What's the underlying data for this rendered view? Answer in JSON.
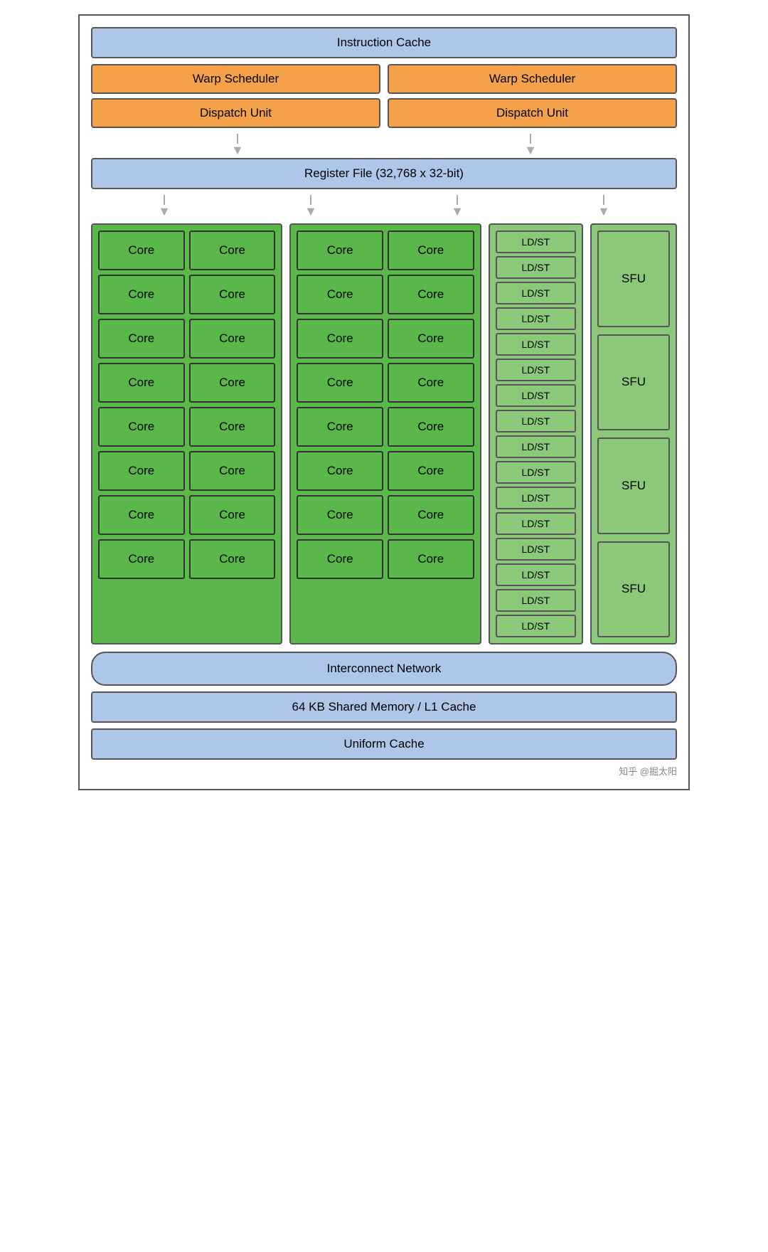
{
  "header": {
    "instruction_cache": "Instruction Cache"
  },
  "warp_schedulers": [
    "Warp Scheduler",
    "Warp Scheduler"
  ],
  "dispatch_units": [
    "Dispatch Unit",
    "Dispatch Unit"
  ],
  "register_file": "Register File (32,768 x 32-bit)",
  "core_groups": [
    {
      "rows": [
        [
          "Core",
          "Core"
        ],
        [
          "Core",
          "Core"
        ],
        [
          "Core",
          "Core"
        ],
        [
          "Core",
          "Core"
        ],
        [
          "Core",
          "Core"
        ],
        [
          "Core",
          "Core"
        ],
        [
          "Core",
          "Core"
        ],
        [
          "Core",
          "Core"
        ]
      ]
    },
    {
      "rows": [
        [
          "Core",
          "Core"
        ],
        [
          "Core",
          "Core"
        ],
        [
          "Core",
          "Core"
        ],
        [
          "Core",
          "Core"
        ],
        [
          "Core",
          "Core"
        ],
        [
          "Core",
          "Core"
        ],
        [
          "Core",
          "Core"
        ],
        [
          "Core",
          "Core"
        ]
      ]
    }
  ],
  "ldst_units": [
    "LD/ST",
    "LD/ST",
    "LD/ST",
    "LD/ST",
    "LD/ST",
    "LD/ST",
    "LD/ST",
    "LD/ST",
    "LD/ST",
    "LD/ST",
    "LD/ST",
    "LD/ST",
    "LD/ST",
    "LD/ST",
    "LD/ST",
    "LD/ST"
  ],
  "sfu_units": [
    "SFU",
    "SFU",
    "SFU",
    "SFU"
  ],
  "interconnect": "Interconnect Network",
  "shared_memory": "64 KB Shared Memory / L1 Cache",
  "uniform_cache": "Uniform Cache",
  "watermark": "知乎 @掘太阳"
}
